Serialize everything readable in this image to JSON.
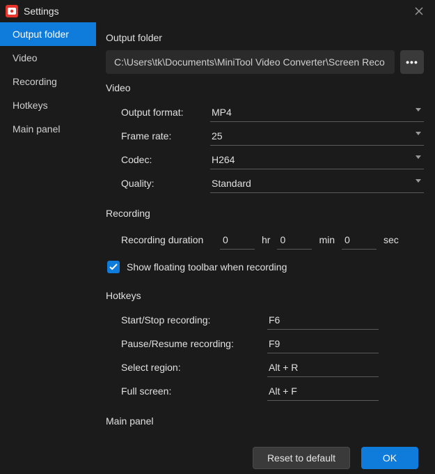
{
  "window": {
    "title": "Settings"
  },
  "sidebar": {
    "items": [
      {
        "label": "Output folder",
        "active": true
      },
      {
        "label": "Video"
      },
      {
        "label": "Recording"
      },
      {
        "label": "Hotkeys"
      },
      {
        "label": "Main panel"
      }
    ]
  },
  "output_folder": {
    "section_label": "Output folder",
    "path": "C:\\Users\\tk\\Documents\\MiniTool Video Converter\\Screen Reco"
  },
  "video": {
    "section_label": "Video",
    "output_format_label": "Output format:",
    "output_format_value": "MP4",
    "frame_rate_label": "Frame rate:",
    "frame_rate_value": "25",
    "codec_label": "Codec:",
    "codec_value": "H264",
    "quality_label": "Quality:",
    "quality_value": "Standard"
  },
  "recording": {
    "section_label": "Recording",
    "duration_label": "Recording duration",
    "hr_value": "0",
    "hr_unit": "hr",
    "min_value": "0",
    "min_unit": "min",
    "sec_value": "0",
    "sec_unit": "sec",
    "show_toolbar_label": "Show floating toolbar when recording",
    "show_toolbar_checked": true
  },
  "hotkeys": {
    "section_label": "Hotkeys",
    "start_stop_label": "Start/Stop recording:",
    "start_stop_value": "F6",
    "pause_resume_label": "Pause/Resume recording:",
    "pause_resume_value": "F9",
    "select_region_label": "Select region:",
    "select_region_value": "Alt + R",
    "full_screen_label": "Full screen:",
    "full_screen_value": "Alt + F"
  },
  "main_panel": {
    "section_label": "Main panel"
  },
  "footer": {
    "reset_label": "Reset to default",
    "ok_label": "OK"
  }
}
